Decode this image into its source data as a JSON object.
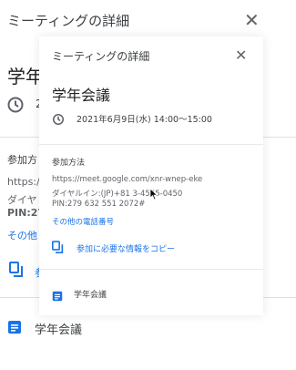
{
  "colors": {
    "link": "#1a73e8",
    "text": "#202124",
    "muted": "#5f6368",
    "doc_icon": "#1a73e8"
  },
  "background": {
    "title": "ミーティングの詳細",
    "event_title_fragment": "学年",
    "date_fragment": "2",
    "join_heading_fragment": "参加方",
    "url_fragment": "https://",
    "dial_fragment": "ダイヤ",
    "pin_fragment": "PIN:27",
    "more_fragment": "その他",
    "copy_fragment": "参",
    "doc_label": "学年会議"
  },
  "card": {
    "title": "ミーティングの詳細",
    "event_title": "学年会議",
    "datetime": "2021年6月9日(水) 14:00～15:00",
    "join_heading": "参加方法",
    "meet_url": "https://meet.google.com/xnr-wnep-eke",
    "dial_in": "ダイヤルイン:(JP)+81 3-4545-0450",
    "pin": "PIN:279 632 551 2072#",
    "more_numbers": "その他の電話番号",
    "copy_label": "参加に必要な情報をコピー",
    "doc_label": "学年会議"
  },
  "icons": [
    "close-icon",
    "clock-icon",
    "copy-icon",
    "document-icon",
    "mouse-cursor-icon"
  ]
}
